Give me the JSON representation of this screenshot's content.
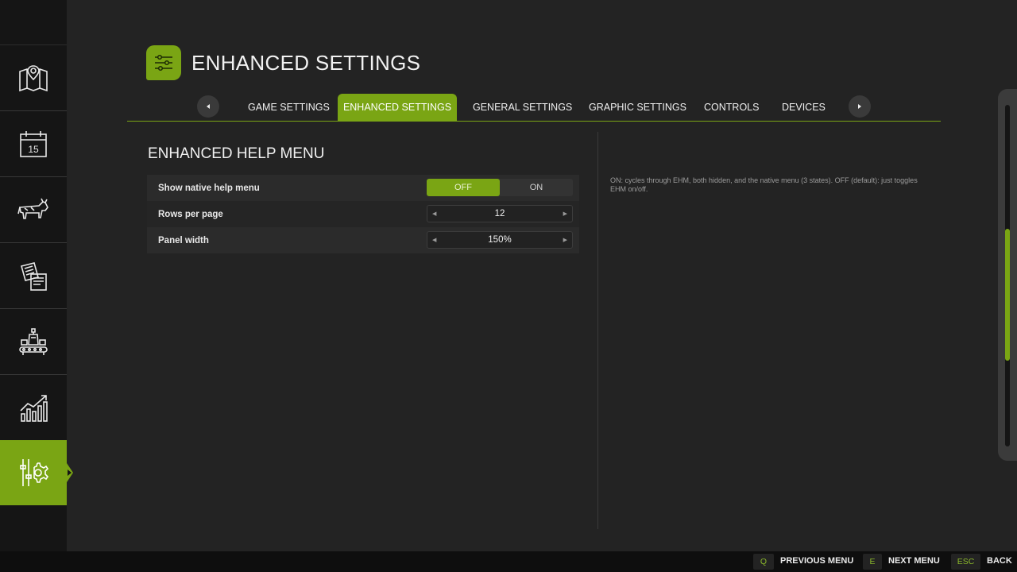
{
  "header": {
    "title": "ENHANCED SETTINGS",
    "icon": "sliders-icon"
  },
  "sidebar": {
    "items": [
      {
        "icon": "map-icon",
        "active": false
      },
      {
        "icon": "calendar-icon",
        "label": "15",
        "active": false
      },
      {
        "icon": "cow-icon",
        "active": false
      },
      {
        "icon": "contracts-icon",
        "active": false
      },
      {
        "icon": "production-icon",
        "active": false
      },
      {
        "icon": "statistics-icon",
        "active": false
      },
      {
        "icon": "settings-gear-icon",
        "active": true
      }
    ]
  },
  "tabs": [
    {
      "label": "GAME SETTINGS",
      "active": false
    },
    {
      "label": "ENHANCED SETTINGS",
      "active": true
    },
    {
      "label": "GENERAL SETTINGS",
      "active": false
    },
    {
      "label": "GRAPHIC SETTINGS",
      "active": false
    },
    {
      "label": "CONTROLS",
      "active": false
    },
    {
      "label": "DEVICES",
      "active": false
    }
  ],
  "section": {
    "title": "ENHANCED HELP MENU",
    "rows": [
      {
        "label": "Show native help menu",
        "type": "toggle",
        "options": [
          "OFF",
          "ON"
        ],
        "selected": "OFF"
      },
      {
        "label": "Rows per page",
        "type": "stepper",
        "value": "12"
      },
      {
        "label": "Panel width",
        "type": "stepper",
        "value": "150%"
      }
    ]
  },
  "help_text": "ON: cycles through EHM, both hidden, and the native menu (3 states). OFF (default): just toggles EHM on/off.",
  "footer": {
    "actions": [
      {
        "key": "Q",
        "label": "PREVIOUS MENU"
      },
      {
        "key": "E",
        "label": "NEXT MENU"
      },
      {
        "key": "ESC",
        "label": "BACK"
      }
    ]
  },
  "colors": {
    "accent": "#7aa514",
    "background": "#232323",
    "sidebar": "#151515"
  },
  "scrollbar": {
    "thumb_start": 0.36,
    "thumb_fraction": 0.39
  }
}
